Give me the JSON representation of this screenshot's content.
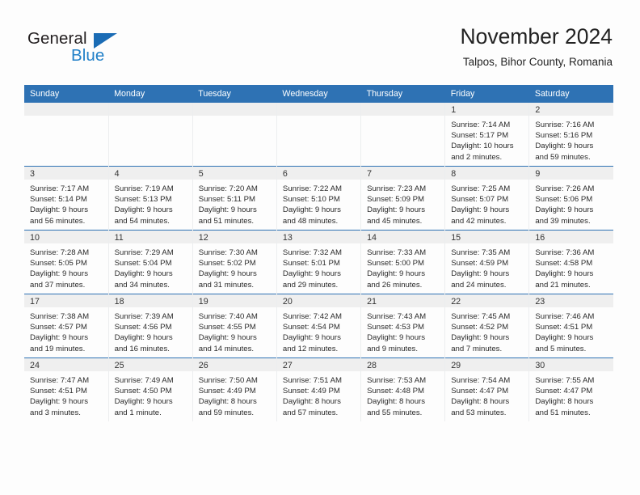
{
  "logo": {
    "text_top": "General",
    "text_bottom": "Blue",
    "triangle_icon": "triangle-icon",
    "brand_dark": "#231f20",
    "brand_blue": "#2180c8"
  },
  "header": {
    "title": "November 2024",
    "subtitle": "Talpos, Bihor County, Romania"
  },
  "theme": {
    "header_blue": "#2e72b4",
    "daynum_bg": "#efefef",
    "page_bg": "#fdfdfd",
    "text": "#2b2b2b"
  },
  "weekday_headers": [
    "Sunday",
    "Monday",
    "Tuesday",
    "Wednesday",
    "Thursday",
    "Friday",
    "Saturday"
  ],
  "labels": {
    "sunrise_prefix": "Sunrise:",
    "sunset_prefix": "Sunset:",
    "daylight_prefix": "Daylight:"
  },
  "weeks": [
    [
      {
        "day": "",
        "empty": true
      },
      {
        "day": "",
        "empty": true
      },
      {
        "day": "",
        "empty": true
      },
      {
        "day": "",
        "empty": true
      },
      {
        "day": "",
        "empty": true
      },
      {
        "day": "1",
        "sunrise": "Sunrise: 7:14 AM",
        "sunset": "Sunset: 5:17 PM",
        "daylight_1": "Daylight: 10 hours",
        "daylight_2": "and 2 minutes."
      },
      {
        "day": "2",
        "sunrise": "Sunrise: 7:16 AM",
        "sunset": "Sunset: 5:16 PM",
        "daylight_1": "Daylight: 9 hours",
        "daylight_2": "and 59 minutes."
      }
    ],
    [
      {
        "day": "3",
        "sunrise": "Sunrise: 7:17 AM",
        "sunset": "Sunset: 5:14 PM",
        "daylight_1": "Daylight: 9 hours",
        "daylight_2": "and 56 minutes."
      },
      {
        "day": "4",
        "sunrise": "Sunrise: 7:19 AM",
        "sunset": "Sunset: 5:13 PM",
        "daylight_1": "Daylight: 9 hours",
        "daylight_2": "and 54 minutes."
      },
      {
        "day": "5",
        "sunrise": "Sunrise: 7:20 AM",
        "sunset": "Sunset: 5:11 PM",
        "daylight_1": "Daylight: 9 hours",
        "daylight_2": "and 51 minutes."
      },
      {
        "day": "6",
        "sunrise": "Sunrise: 7:22 AM",
        "sunset": "Sunset: 5:10 PM",
        "daylight_1": "Daylight: 9 hours",
        "daylight_2": "and 48 minutes."
      },
      {
        "day": "7",
        "sunrise": "Sunrise: 7:23 AM",
        "sunset": "Sunset: 5:09 PM",
        "daylight_1": "Daylight: 9 hours",
        "daylight_2": "and 45 minutes."
      },
      {
        "day": "8",
        "sunrise": "Sunrise: 7:25 AM",
        "sunset": "Sunset: 5:07 PM",
        "daylight_1": "Daylight: 9 hours",
        "daylight_2": "and 42 minutes."
      },
      {
        "day": "9",
        "sunrise": "Sunrise: 7:26 AM",
        "sunset": "Sunset: 5:06 PM",
        "daylight_1": "Daylight: 9 hours",
        "daylight_2": "and 39 minutes."
      }
    ],
    [
      {
        "day": "10",
        "sunrise": "Sunrise: 7:28 AM",
        "sunset": "Sunset: 5:05 PM",
        "daylight_1": "Daylight: 9 hours",
        "daylight_2": "and 37 minutes."
      },
      {
        "day": "11",
        "sunrise": "Sunrise: 7:29 AM",
        "sunset": "Sunset: 5:04 PM",
        "daylight_1": "Daylight: 9 hours",
        "daylight_2": "and 34 minutes."
      },
      {
        "day": "12",
        "sunrise": "Sunrise: 7:30 AM",
        "sunset": "Sunset: 5:02 PM",
        "daylight_1": "Daylight: 9 hours",
        "daylight_2": "and 31 minutes."
      },
      {
        "day": "13",
        "sunrise": "Sunrise: 7:32 AM",
        "sunset": "Sunset: 5:01 PM",
        "daylight_1": "Daylight: 9 hours",
        "daylight_2": "and 29 minutes."
      },
      {
        "day": "14",
        "sunrise": "Sunrise: 7:33 AM",
        "sunset": "Sunset: 5:00 PM",
        "daylight_1": "Daylight: 9 hours",
        "daylight_2": "and 26 minutes."
      },
      {
        "day": "15",
        "sunrise": "Sunrise: 7:35 AM",
        "sunset": "Sunset: 4:59 PM",
        "daylight_1": "Daylight: 9 hours",
        "daylight_2": "and 24 minutes."
      },
      {
        "day": "16",
        "sunrise": "Sunrise: 7:36 AM",
        "sunset": "Sunset: 4:58 PM",
        "daylight_1": "Daylight: 9 hours",
        "daylight_2": "and 21 minutes."
      }
    ],
    [
      {
        "day": "17",
        "sunrise": "Sunrise: 7:38 AM",
        "sunset": "Sunset: 4:57 PM",
        "daylight_1": "Daylight: 9 hours",
        "daylight_2": "and 19 minutes."
      },
      {
        "day": "18",
        "sunrise": "Sunrise: 7:39 AM",
        "sunset": "Sunset: 4:56 PM",
        "daylight_1": "Daylight: 9 hours",
        "daylight_2": "and 16 minutes."
      },
      {
        "day": "19",
        "sunrise": "Sunrise: 7:40 AM",
        "sunset": "Sunset: 4:55 PM",
        "daylight_1": "Daylight: 9 hours",
        "daylight_2": "and 14 minutes."
      },
      {
        "day": "20",
        "sunrise": "Sunrise: 7:42 AM",
        "sunset": "Sunset: 4:54 PM",
        "daylight_1": "Daylight: 9 hours",
        "daylight_2": "and 12 minutes."
      },
      {
        "day": "21",
        "sunrise": "Sunrise: 7:43 AM",
        "sunset": "Sunset: 4:53 PM",
        "daylight_1": "Daylight: 9 hours",
        "daylight_2": "and 9 minutes."
      },
      {
        "day": "22",
        "sunrise": "Sunrise: 7:45 AM",
        "sunset": "Sunset: 4:52 PM",
        "daylight_1": "Daylight: 9 hours",
        "daylight_2": "and 7 minutes."
      },
      {
        "day": "23",
        "sunrise": "Sunrise: 7:46 AM",
        "sunset": "Sunset: 4:51 PM",
        "daylight_1": "Daylight: 9 hours",
        "daylight_2": "and 5 minutes."
      }
    ],
    [
      {
        "day": "24",
        "sunrise": "Sunrise: 7:47 AM",
        "sunset": "Sunset: 4:51 PM",
        "daylight_1": "Daylight: 9 hours",
        "daylight_2": "and 3 minutes."
      },
      {
        "day": "25",
        "sunrise": "Sunrise: 7:49 AM",
        "sunset": "Sunset: 4:50 PM",
        "daylight_1": "Daylight: 9 hours",
        "daylight_2": "and 1 minute."
      },
      {
        "day": "26",
        "sunrise": "Sunrise: 7:50 AM",
        "sunset": "Sunset: 4:49 PM",
        "daylight_1": "Daylight: 8 hours",
        "daylight_2": "and 59 minutes."
      },
      {
        "day": "27",
        "sunrise": "Sunrise: 7:51 AM",
        "sunset": "Sunset: 4:49 PM",
        "daylight_1": "Daylight: 8 hours",
        "daylight_2": "and 57 minutes."
      },
      {
        "day": "28",
        "sunrise": "Sunrise: 7:53 AM",
        "sunset": "Sunset: 4:48 PM",
        "daylight_1": "Daylight: 8 hours",
        "daylight_2": "and 55 minutes."
      },
      {
        "day": "29",
        "sunrise": "Sunrise: 7:54 AM",
        "sunset": "Sunset: 4:47 PM",
        "daylight_1": "Daylight: 8 hours",
        "daylight_2": "and 53 minutes."
      },
      {
        "day": "30",
        "sunrise": "Sunrise: 7:55 AM",
        "sunset": "Sunset: 4:47 PM",
        "daylight_1": "Daylight: 8 hours",
        "daylight_2": "and 51 minutes."
      }
    ]
  ]
}
